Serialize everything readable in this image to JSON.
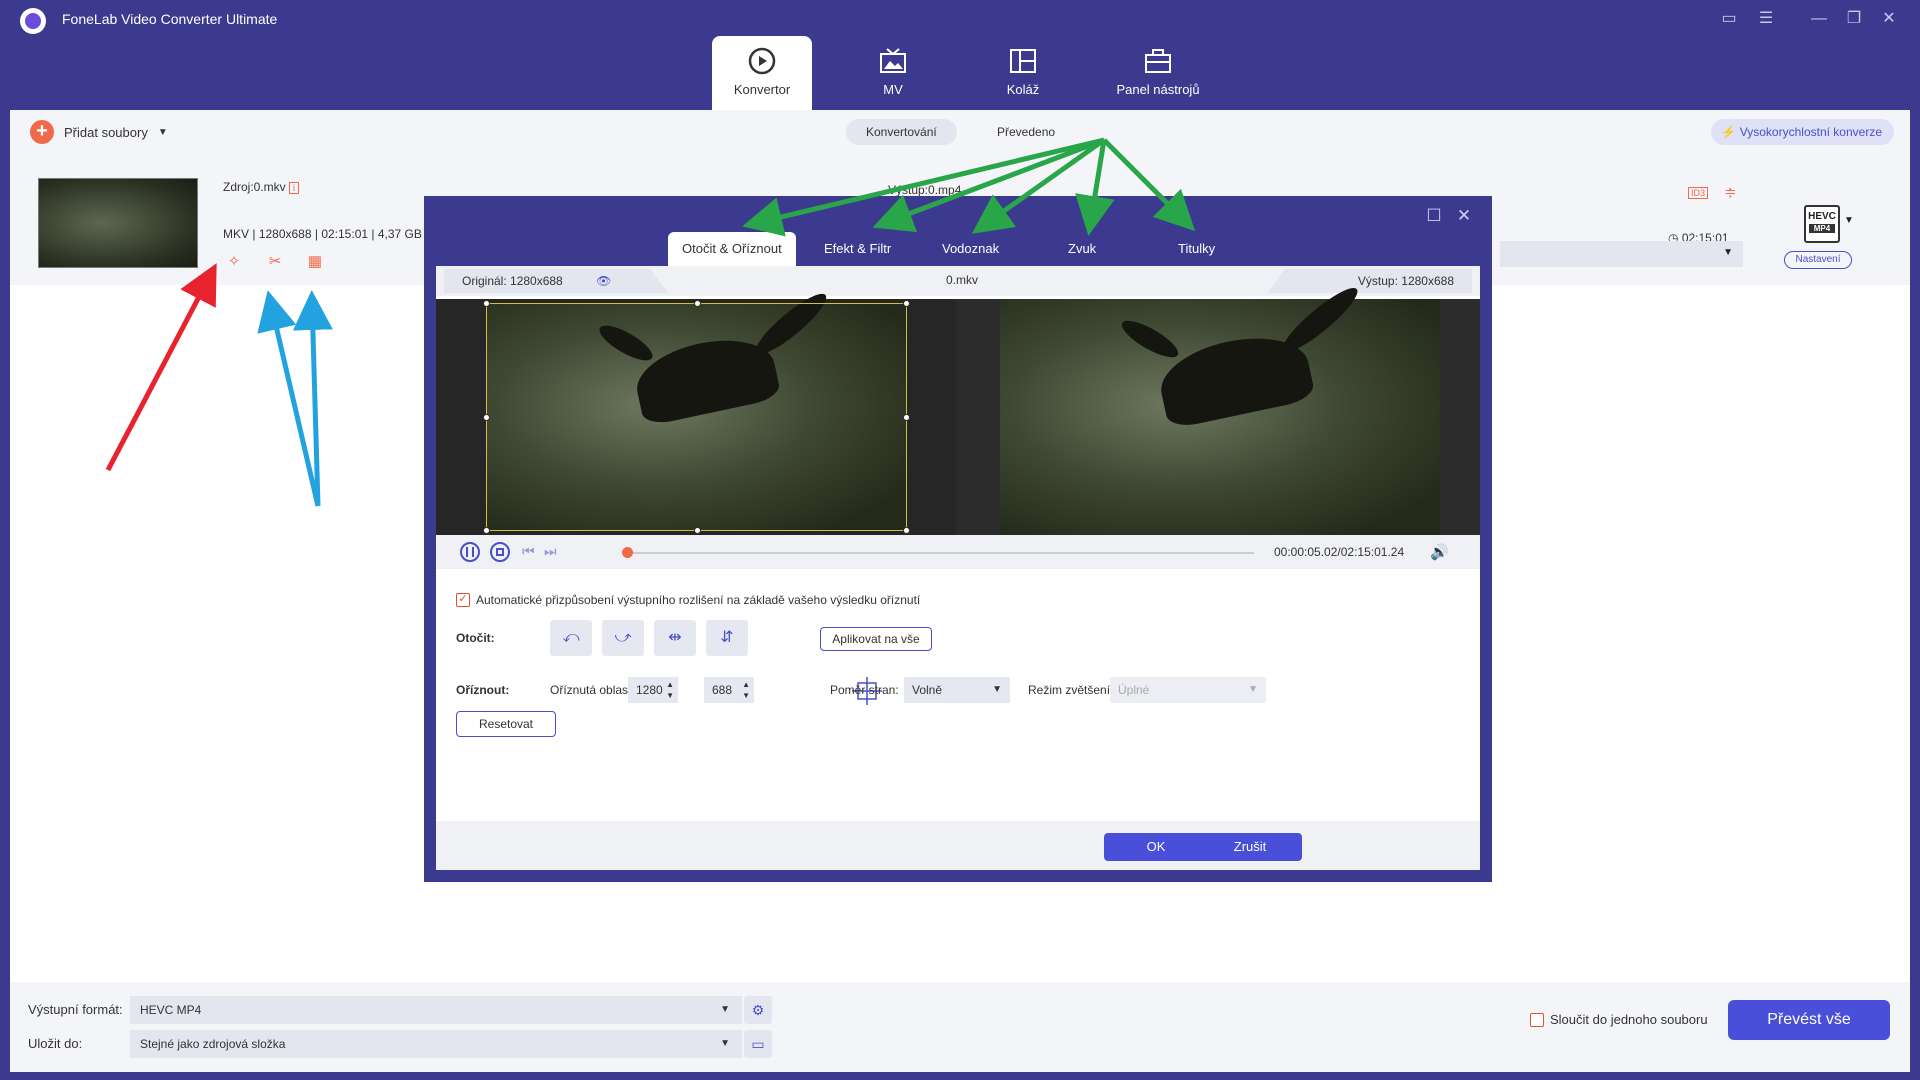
{
  "app": {
    "title": "FoneLab Video Converter Ultimate"
  },
  "nav": {
    "tabs": [
      {
        "label": "Konvertor"
      },
      {
        "label": "MV"
      },
      {
        "label": "Koláž"
      },
      {
        "label": "Panel nástrojů"
      }
    ]
  },
  "toolbar": {
    "add_files": "Přidat soubory",
    "converting": "Konvertování",
    "converted": "Převedeno",
    "turbo": "Vysokorychlostní konverze"
  },
  "file": {
    "source": "Zdroj:0.mkv",
    "format": "MKV",
    "resolution": "1280x688",
    "duration": "02:15:01",
    "size": "4,37 GB",
    "output": "Výstup:0.mp4",
    "output_duration": "02:15:01",
    "format_badge_top": "HEVC",
    "format_badge_bottom": "MP4",
    "settings": "Nastavení"
  },
  "dialog": {
    "tabs": [
      {
        "label": "Otočit & Oříznout"
      },
      {
        "label": "Efekt & Filtr"
      },
      {
        "label": "Vodoznak"
      },
      {
        "label": "Zvuk"
      },
      {
        "label": "Titulky"
      }
    ],
    "original": "Originál: 1280x688",
    "filename": "0.mkv",
    "output": "Výstup: 1280x688",
    "time": "00:00:05.02/02:15:01.24",
    "auto_adjust": "Automatické přizpůsobení výstupního rozlišení na základě vašeho výsledku oříznutí",
    "rotate_label": "Otočit:",
    "apply_all": "Aplikovat na vše",
    "crop_label": "Oříznout:",
    "crop_area_label": "Oříznutá oblast:",
    "crop_width": "1280",
    "crop_height": "688",
    "aspect_label": "Poměr stran:",
    "aspect_value": "Volně",
    "zoom_label": "Režim zvětšení:",
    "zoom_value": "Úplné",
    "reset": "Resetovat",
    "ok": "OK",
    "cancel": "Zrušit"
  },
  "bottom": {
    "output_format_label": "Výstupní formát:",
    "output_format_value": "HEVC MP4",
    "save_to_label": "Uložit do:",
    "save_to_value": "Stejné jako zdrojová složka",
    "merge": "Sloučit do jednoho souboru",
    "convert_all": "Převést vše"
  },
  "colors": {
    "brand": "#3b3a8f",
    "accent": "#4a4fd9",
    "orange": "#f06a4a",
    "arrow_red": "#e8232e",
    "arrow_blue": "#22a3e0",
    "arrow_green": "#2aa64a"
  }
}
